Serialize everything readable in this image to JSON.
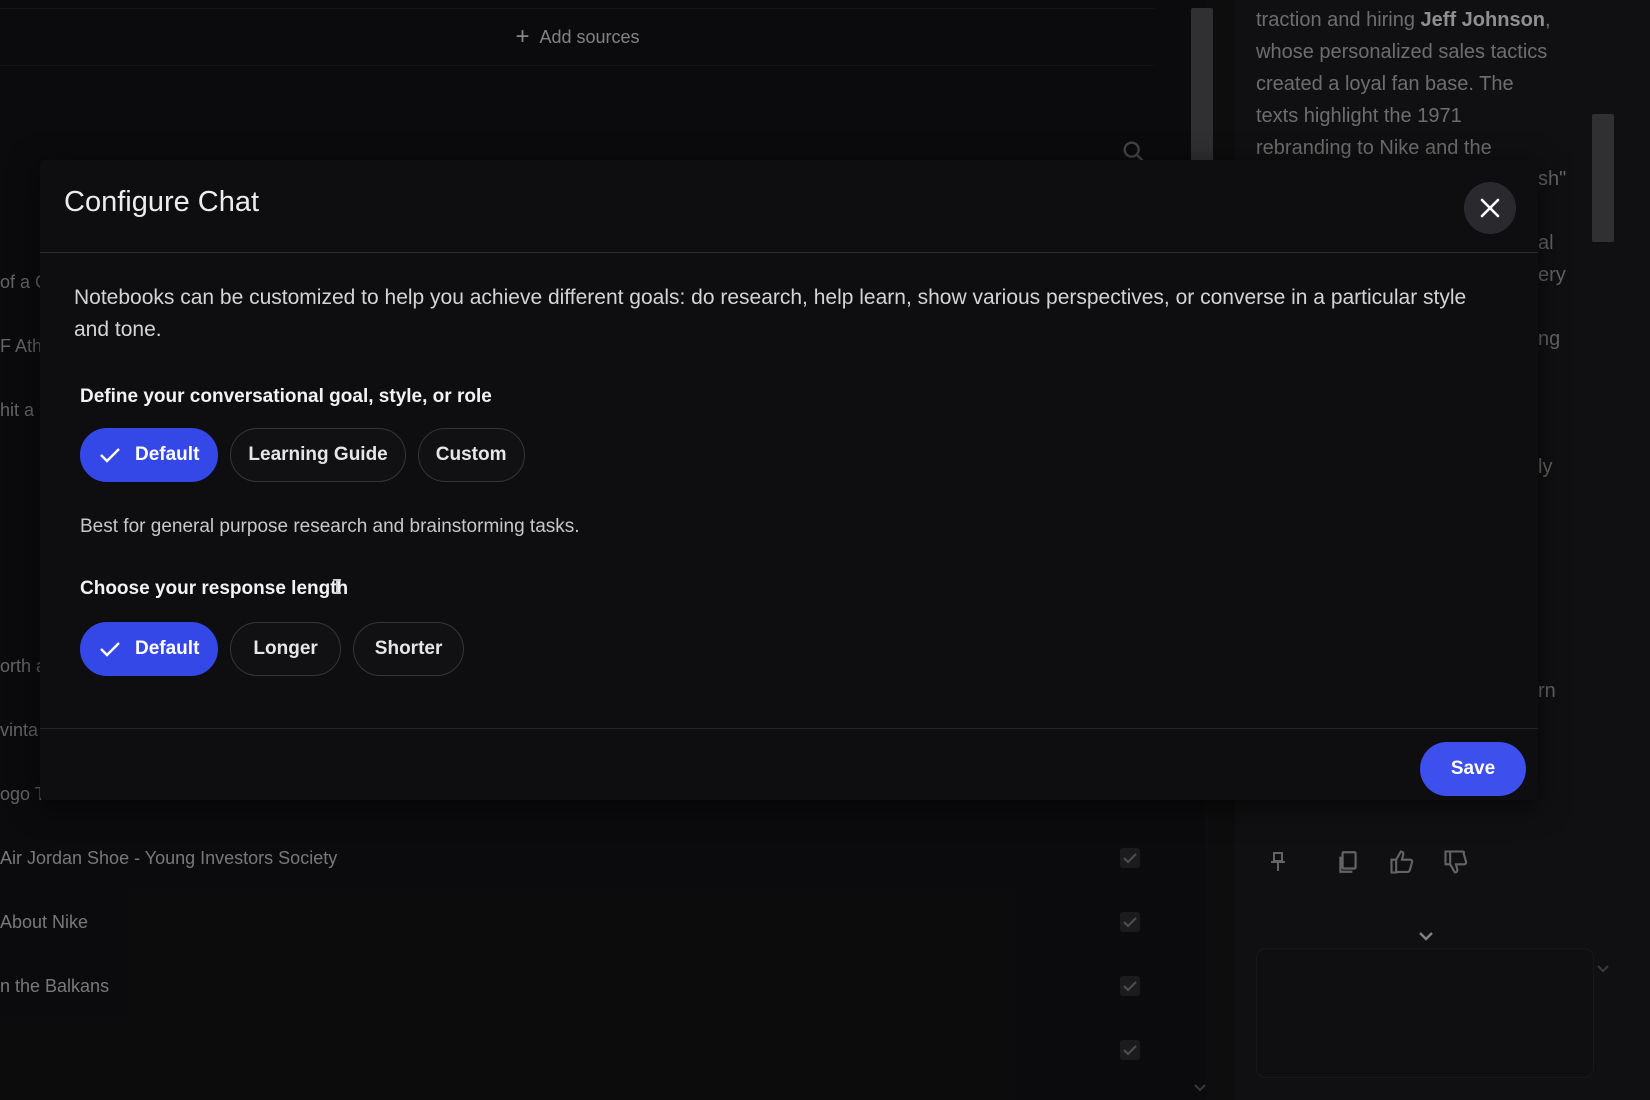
{
  "background": {
    "add_sources_label": "Add sources",
    "left_snippets": [
      "of a C",
      "F Athl",
      "hit a",
      "orth a",
      "vinta",
      "ogo To"
    ],
    "sources": [
      {
        "title": "Air Jordan Shoe - Young Investors Society"
      },
      {
        "title": "About Nike"
      },
      {
        "title": "n the Balkans"
      },
      {
        "title": ""
      }
    ],
    "right_panel": {
      "text_1": "traction and hiring ",
      "bold_1": "Jeff Johnson",
      "text_2": ", whose personalized sales tactics created a loyal fan base. The texts highlight the 1971 rebranding to Nike and the",
      "snippets": [
        "sh\"",
        "al",
        "ery",
        "ng",
        "ly",
        "rn"
      ]
    }
  },
  "modal": {
    "title": "Configure Chat",
    "description": "Notebooks can be customized to help you achieve different goals: do research, help learn, show various perspectives, or converse in a particular style and tone.",
    "goal_label": "Define your conversational goal, style, or role",
    "goal_options": [
      "Default",
      "Learning Guide",
      "Custom"
    ],
    "goal_selected": "Default",
    "goal_hint": "Best for general purpose research and brainstorming tasks.",
    "length_label": "Choose your response length",
    "length_options": [
      "Default",
      "Longer",
      "Shorter"
    ],
    "length_selected": "Default",
    "save_label": "Save"
  },
  "colors": {
    "accent": "#3448e8",
    "modal_bg": "#0e0e10",
    "page_bg": "#141416"
  }
}
